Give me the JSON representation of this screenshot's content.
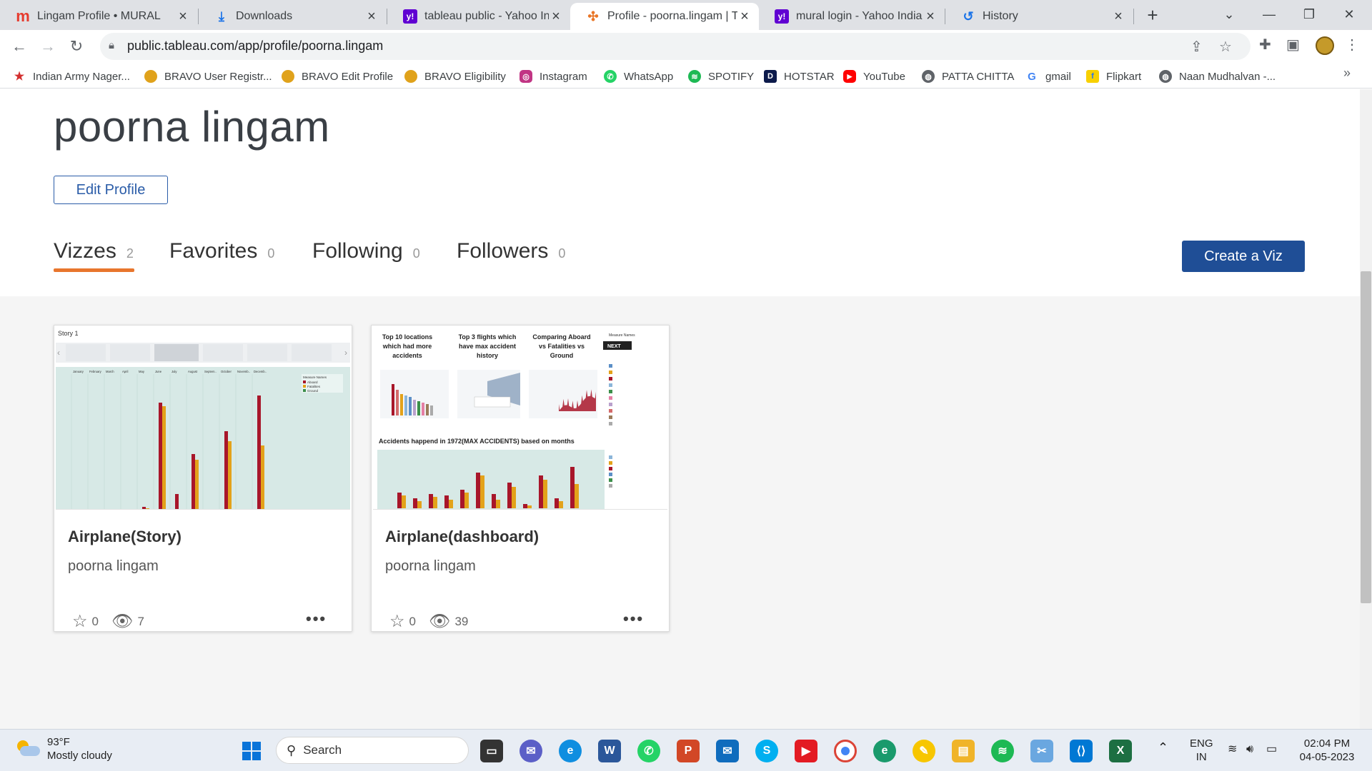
{
  "browser": {
    "tabs": [
      {
        "title": "Lingam Profile • MURAL",
        "favicon": "mural-icon",
        "color": "#e63b2e",
        "glyph": "m"
      },
      {
        "title": "Downloads",
        "favicon": "download-icon",
        "color": "#1a73e8",
        "glyph": "⤓"
      },
      {
        "title": "tableau public - Yahoo India",
        "favicon": "yahoo-icon",
        "color": "#6001d2",
        "glyph": "y!"
      },
      {
        "title": "Profile - poorna.lingam | Tal",
        "favicon": "tableau-icon",
        "color": "#e97627",
        "glyph": "✣"
      },
      {
        "title": "mural login - Yahoo India S",
        "favicon": "yahoo-icon",
        "color": "#6001d2",
        "glyph": "y!"
      },
      {
        "title": "History",
        "favicon": "history-icon",
        "color": "#1a73e8",
        "glyph": "↺"
      }
    ],
    "url": "public.tableau.com/app/profile/poorna.lingam"
  },
  "bookmarks": [
    {
      "label": "Indian Army Nager...",
      "icon": "army-icon",
      "color": "#d32f2f",
      "glyph": "★"
    },
    {
      "label": "BRAVO User Registr...",
      "icon": "bravo-icon",
      "color": "#e0a21b",
      "glyph": "●"
    },
    {
      "label": "BRAVO Edit Profile",
      "icon": "bravo-icon",
      "color": "#e0a21b",
      "glyph": "●"
    },
    {
      "label": "BRAVO Eligibility",
      "icon": "bravo-icon",
      "color": "#e0a21b",
      "glyph": "●"
    },
    {
      "label": "Instagram",
      "icon": "instagram-icon",
      "color": "#c13584",
      "glyph": "◎"
    },
    {
      "label": "WhatsApp",
      "icon": "whatsapp-icon",
      "color": "#25d366",
      "glyph": "✆"
    },
    {
      "label": "SPOTIFY",
      "icon": "spotify-icon",
      "color": "#1db954",
      "glyph": "≋"
    },
    {
      "label": "HOTSTAR",
      "icon": "hotstar-icon",
      "color": "#0c1a4b",
      "glyph": "D"
    },
    {
      "label": "YouTube",
      "icon": "youtube-icon",
      "color": "#ff0000",
      "glyph": "▶"
    },
    {
      "label": "PATTA CHITTA",
      "icon": "globe-icon",
      "color": "#5f6368",
      "glyph": "◍"
    },
    {
      "label": "gmail",
      "icon": "google-icon",
      "color": "#4285f4",
      "glyph": "G"
    },
    {
      "label": "Flipkart",
      "icon": "flipkart-icon",
      "color": "#f8d000",
      "glyph": "f"
    },
    {
      "label": "Naan Mudhalvan -...",
      "icon": "globe-icon",
      "color": "#5f6368",
      "glyph": "◍"
    }
  ],
  "profile": {
    "name": "poorna lingam",
    "edit_label": "Edit Profile",
    "tabs": [
      {
        "label": "Vizzes",
        "count": "2"
      },
      {
        "label": "Favorites",
        "count": "0"
      },
      {
        "label": "Following",
        "count": "0"
      },
      {
        "label": "Followers",
        "count": "0"
      }
    ],
    "create_label": "Create a Viz"
  },
  "vizzes": [
    {
      "title": "Airplane(Story)",
      "author": "poorna lingam",
      "favorites": "0",
      "views": "7",
      "thumb": {
        "story_label": "Story 1",
        "months": [
          "January",
          "February",
          "March",
          "April",
          "May",
          "June",
          "July",
          "August",
          "Septem..",
          "October",
          "Novemb..",
          "Decemb.."
        ],
        "legend_title": "Measure Names",
        "legend": [
          "Aboard",
          "Fatalities",
          "Ground"
        ]
      }
    },
    {
      "title": "Airplane(dashboard)",
      "author": "poorna lingam",
      "favorites": "0",
      "views": "39",
      "thumb": {
        "heading1": "Top 10 locations which had more accidents",
        "heading2": "Top 3 flights which have max accident history",
        "heading3": "Comparing Aboard vs Fatalities vs Ground",
        "bottom_title": "Accidents happend in 1972(MAX ACCIDENTS) based on months",
        "next_label": "NEXT",
        "legend_title": "Measure Names"
      }
    }
  ],
  "taskbar": {
    "weather_temp": "93°F",
    "weather_desc": "Mostly cloudy",
    "search_label": "Search",
    "lang_top": "ENG",
    "lang_bottom": "IN",
    "time": "02:04 PM",
    "date": "04-05-2023"
  },
  "colors": {
    "accent_orange": "#e8762d",
    "tableau_blue": "#1f4e96",
    "aboard": "#a8162a",
    "fatalities": "#e3a21a",
    "ground": "#3c8f4a"
  }
}
